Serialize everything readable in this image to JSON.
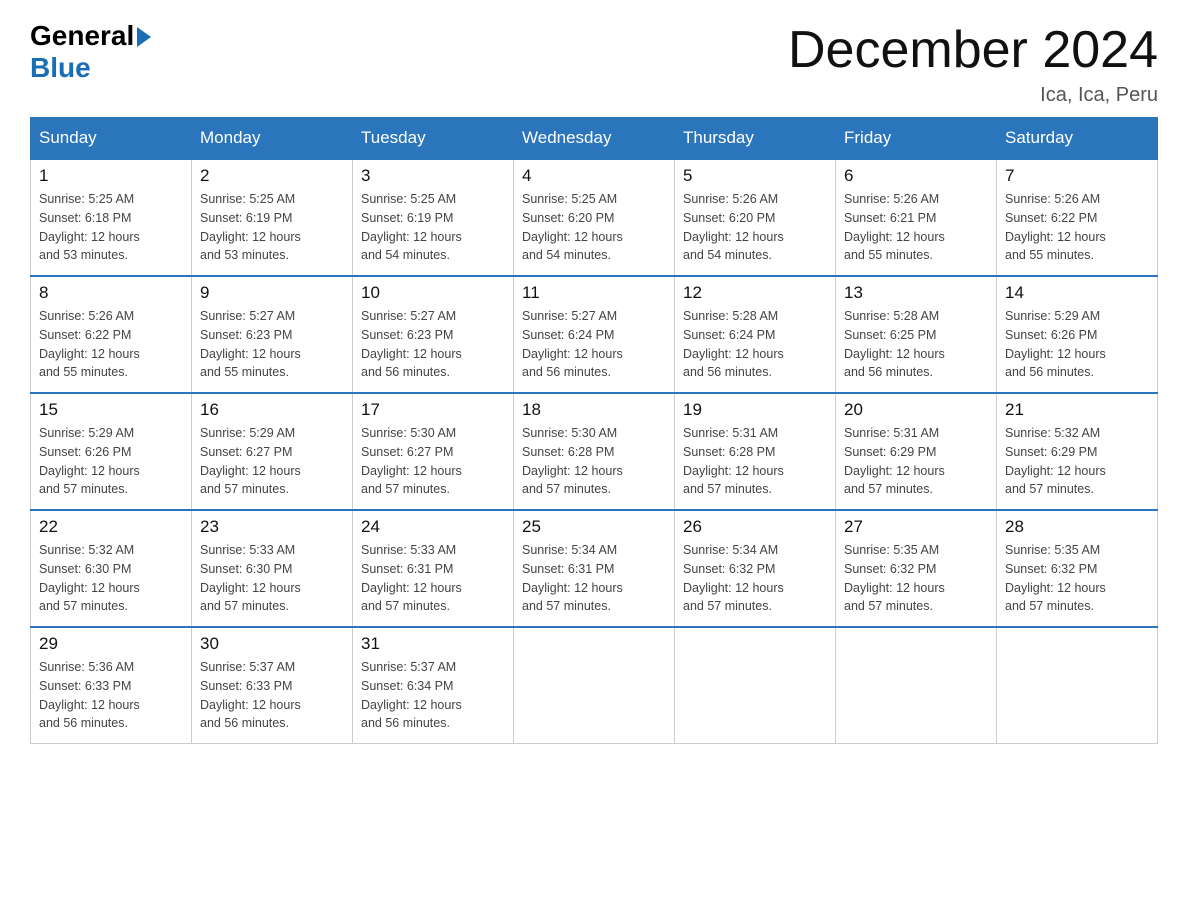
{
  "logo": {
    "general": "General",
    "blue": "Blue"
  },
  "title": "December 2024",
  "location": "Ica, Ica, Peru",
  "days_of_week": [
    "Sunday",
    "Monday",
    "Tuesday",
    "Wednesday",
    "Thursday",
    "Friday",
    "Saturday"
  ],
  "weeks": [
    [
      {
        "day": "1",
        "sunrise": "5:25 AM",
        "sunset": "6:18 PM",
        "daylight": "12 hours and 53 minutes."
      },
      {
        "day": "2",
        "sunrise": "5:25 AM",
        "sunset": "6:19 PM",
        "daylight": "12 hours and 53 minutes."
      },
      {
        "day": "3",
        "sunrise": "5:25 AM",
        "sunset": "6:19 PM",
        "daylight": "12 hours and 54 minutes."
      },
      {
        "day": "4",
        "sunrise": "5:25 AM",
        "sunset": "6:20 PM",
        "daylight": "12 hours and 54 minutes."
      },
      {
        "day": "5",
        "sunrise": "5:26 AM",
        "sunset": "6:20 PM",
        "daylight": "12 hours and 54 minutes."
      },
      {
        "day": "6",
        "sunrise": "5:26 AM",
        "sunset": "6:21 PM",
        "daylight": "12 hours and 55 minutes."
      },
      {
        "day": "7",
        "sunrise": "5:26 AM",
        "sunset": "6:22 PM",
        "daylight": "12 hours and 55 minutes."
      }
    ],
    [
      {
        "day": "8",
        "sunrise": "5:26 AM",
        "sunset": "6:22 PM",
        "daylight": "12 hours and 55 minutes."
      },
      {
        "day": "9",
        "sunrise": "5:27 AM",
        "sunset": "6:23 PM",
        "daylight": "12 hours and 55 minutes."
      },
      {
        "day": "10",
        "sunrise": "5:27 AM",
        "sunset": "6:23 PM",
        "daylight": "12 hours and 56 minutes."
      },
      {
        "day": "11",
        "sunrise": "5:27 AM",
        "sunset": "6:24 PM",
        "daylight": "12 hours and 56 minutes."
      },
      {
        "day": "12",
        "sunrise": "5:28 AM",
        "sunset": "6:24 PM",
        "daylight": "12 hours and 56 minutes."
      },
      {
        "day": "13",
        "sunrise": "5:28 AM",
        "sunset": "6:25 PM",
        "daylight": "12 hours and 56 minutes."
      },
      {
        "day": "14",
        "sunrise": "5:29 AM",
        "sunset": "6:26 PM",
        "daylight": "12 hours and 56 minutes."
      }
    ],
    [
      {
        "day": "15",
        "sunrise": "5:29 AM",
        "sunset": "6:26 PM",
        "daylight": "12 hours and 57 minutes."
      },
      {
        "day": "16",
        "sunrise": "5:29 AM",
        "sunset": "6:27 PM",
        "daylight": "12 hours and 57 minutes."
      },
      {
        "day": "17",
        "sunrise": "5:30 AM",
        "sunset": "6:27 PM",
        "daylight": "12 hours and 57 minutes."
      },
      {
        "day": "18",
        "sunrise": "5:30 AM",
        "sunset": "6:28 PM",
        "daylight": "12 hours and 57 minutes."
      },
      {
        "day": "19",
        "sunrise": "5:31 AM",
        "sunset": "6:28 PM",
        "daylight": "12 hours and 57 minutes."
      },
      {
        "day": "20",
        "sunrise": "5:31 AM",
        "sunset": "6:29 PM",
        "daylight": "12 hours and 57 minutes."
      },
      {
        "day": "21",
        "sunrise": "5:32 AM",
        "sunset": "6:29 PM",
        "daylight": "12 hours and 57 minutes."
      }
    ],
    [
      {
        "day": "22",
        "sunrise": "5:32 AM",
        "sunset": "6:30 PM",
        "daylight": "12 hours and 57 minutes."
      },
      {
        "day": "23",
        "sunrise": "5:33 AM",
        "sunset": "6:30 PM",
        "daylight": "12 hours and 57 minutes."
      },
      {
        "day": "24",
        "sunrise": "5:33 AM",
        "sunset": "6:31 PM",
        "daylight": "12 hours and 57 minutes."
      },
      {
        "day": "25",
        "sunrise": "5:34 AM",
        "sunset": "6:31 PM",
        "daylight": "12 hours and 57 minutes."
      },
      {
        "day": "26",
        "sunrise": "5:34 AM",
        "sunset": "6:32 PM",
        "daylight": "12 hours and 57 minutes."
      },
      {
        "day": "27",
        "sunrise": "5:35 AM",
        "sunset": "6:32 PM",
        "daylight": "12 hours and 57 minutes."
      },
      {
        "day": "28",
        "sunrise": "5:35 AM",
        "sunset": "6:32 PM",
        "daylight": "12 hours and 57 minutes."
      }
    ],
    [
      {
        "day": "29",
        "sunrise": "5:36 AM",
        "sunset": "6:33 PM",
        "daylight": "12 hours and 56 minutes."
      },
      {
        "day": "30",
        "sunrise": "5:37 AM",
        "sunset": "6:33 PM",
        "daylight": "12 hours and 56 minutes."
      },
      {
        "day": "31",
        "sunrise": "5:37 AM",
        "sunset": "6:34 PM",
        "daylight": "12 hours and 56 minutes."
      },
      null,
      null,
      null,
      null
    ]
  ],
  "labels": {
    "sunrise": "Sunrise:",
    "sunset": "Sunset:",
    "daylight": "Daylight:"
  }
}
